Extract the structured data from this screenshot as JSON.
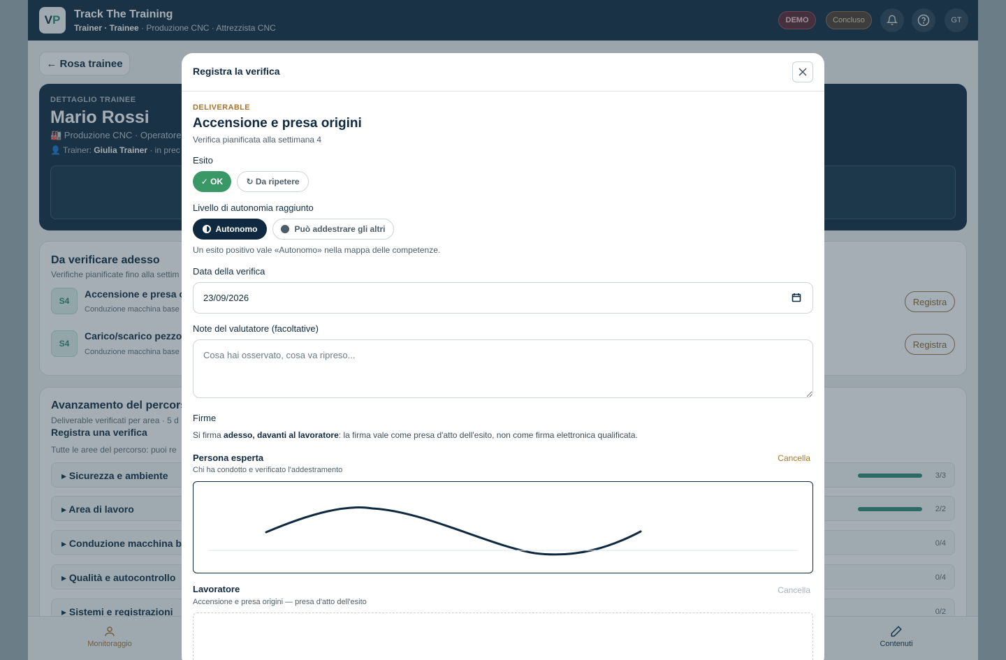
{
  "app": {
    "logo_text": "VP",
    "title": "Track The Training",
    "breadcrumb_bold": "Trainer · Trainee",
    "breadcrumb_rest": " · Produzione CNC · Attrezzista CNC",
    "demo_badge": "DEMO",
    "status_badge": "Concluso",
    "avatar_initials": "GT"
  },
  "background": {
    "back_label": "← Rosa trainee",
    "hero": {
      "eyebrow": "DETTAGLIO TRAINEE",
      "name": "Mario Rossi",
      "line1": "🏭 Produzione CNC · Operatore C",
      "trainer_prefix": "👤 Trainer: ",
      "trainer_name": "Giulia Trainer",
      "trainer_suffix": " · in prec"
    },
    "verify_now": {
      "title": "Da verificare adesso",
      "subtitle": "Verifiche pianificate fino alla settim",
      "items": [
        {
          "week": "S4",
          "title": "Accensione e presa orig",
          "area": "Conduzione macchina base",
          "action": "Registra"
        },
        {
          "week": "S4",
          "title": "Carico/scarico pezzo e",
          "area": "Conduzione macchina base",
          "action": "Registra"
        }
      ]
    },
    "progress": {
      "title": "Avanzamento del percors",
      "subtitle": "Deliverable verificati per area · 5 d",
      "register_title": "Registra una verifica",
      "register_sub": "Tutte le aree del percorso: puoi re",
      "areas": [
        {
          "label": "▸  Sicurezza e ambiente",
          "count": "3/3",
          "fill": 1
        },
        {
          "label": "▸  Area di lavoro",
          "count": "2/2",
          "fill": 1
        },
        {
          "label": "▸  Conduzione macchina bas",
          "count": "0/4",
          "fill": 0
        },
        {
          "label": "▸  Qualità e autocontrollo",
          "count": "0/4",
          "fill": 0
        },
        {
          "label": "▸  Sistemi e registrazioni",
          "count": "0/2",
          "fill": 0
        }
      ]
    },
    "nav": {
      "monitor": "Monitoraggio",
      "content": "Contenuti"
    }
  },
  "modal": {
    "title": "Registra la verifica",
    "eyebrow": "DELIVERABLE",
    "heading": "Accensione e presa origini",
    "planned": "Verifica pianificata alla settimana 4",
    "outcome_label": "Esito",
    "outcome_ok": "✓ OK",
    "outcome_repeat": "↻ Da ripetere",
    "level_label": "Livello di autonomia raggiunto",
    "level_auto": "Autonomo",
    "level_train": "Può addestrare gli altri",
    "level_hint": "Un esito positivo vale «Autonomo» nella mappa delle competenze.",
    "date_label": "Data della verifica",
    "date_value": "23/09/2026",
    "notes_label": "Note del valutatore (facoltative)",
    "notes_placeholder": "Cosa hai osservato, cosa va ripreso...",
    "signatures_label": "Firme",
    "signatures_info_pre": "Si firma ",
    "signatures_info_bold": "adesso, davanti al lavoratore",
    "signatures_info_post": ": la firma vale come presa d'atto dell'esito, non come firma elettronica qualificata.",
    "expert_title": "Persona esperta",
    "expert_sub": "Chi ha condotto e verificato l'addestramento",
    "clear": "Cancella",
    "worker_title": "Lavoratore",
    "worker_sub": "Accensione e presa origini — presa d'atto dell'esito",
    "colors": {
      "primary": "#0f2a40",
      "ok": "#3a9867",
      "accent": "#a7762c"
    }
  }
}
